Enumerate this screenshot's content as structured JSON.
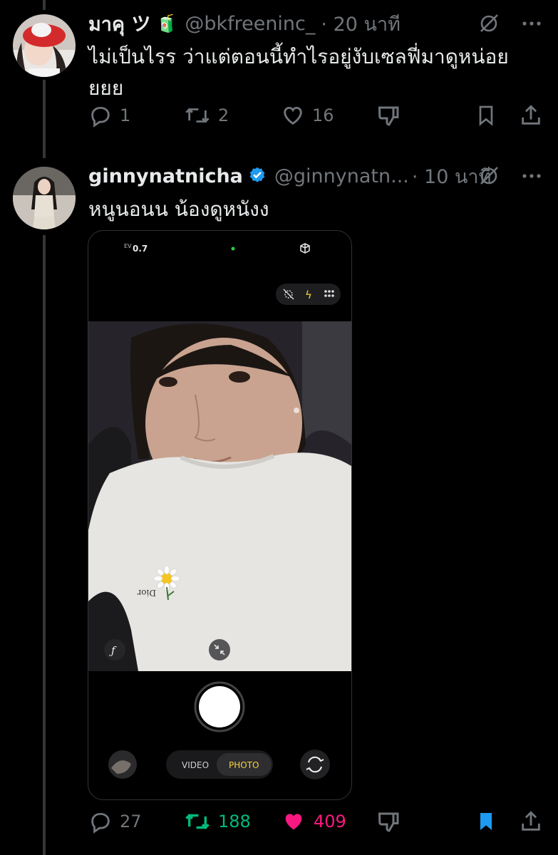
{
  "tweet1": {
    "display_name": "มาคุ ツ",
    "name_emoji": "🧃",
    "handle": "@bkfreeninc_",
    "time": "· 20 นาที",
    "text": "ไม่เป็นไรร ว่าแต่ตอนนี้ทำไรอยู่งับเซลฟี่มาดูหน่อยยยย",
    "counts": {
      "replies": "1",
      "reposts": "2",
      "likes": "16"
    }
  },
  "tweet2": {
    "display_name": "ginnynatnicha",
    "verified": true,
    "handle": "@ginnynatn...",
    "time": "· 10 นาที",
    "text": "หนูนอนน น้องดูหนังง",
    "counts": {
      "replies": "27",
      "reposts": "188",
      "likes": "409"
    },
    "reposted": true,
    "liked": true,
    "bookmarked": true
  },
  "camera": {
    "ev_label": "EV",
    "ev_value": "0.7",
    "mode_video": "VIDEO",
    "mode_photo": "PHOTO",
    "shirt_brand": "Dior"
  },
  "colors": {
    "background": "#000000",
    "muted": "#71767b",
    "verified": "#1d9bf0",
    "repost_active": "#00ba7c",
    "like_active": "#f91880",
    "camera_accent": "#f5d33b"
  },
  "icons": [
    "grok-icon",
    "more-icon",
    "reply-icon",
    "repost-icon",
    "like-icon",
    "downvote-icon",
    "bookmark-icon",
    "share-icon",
    "verified-badge-icon"
  ]
}
